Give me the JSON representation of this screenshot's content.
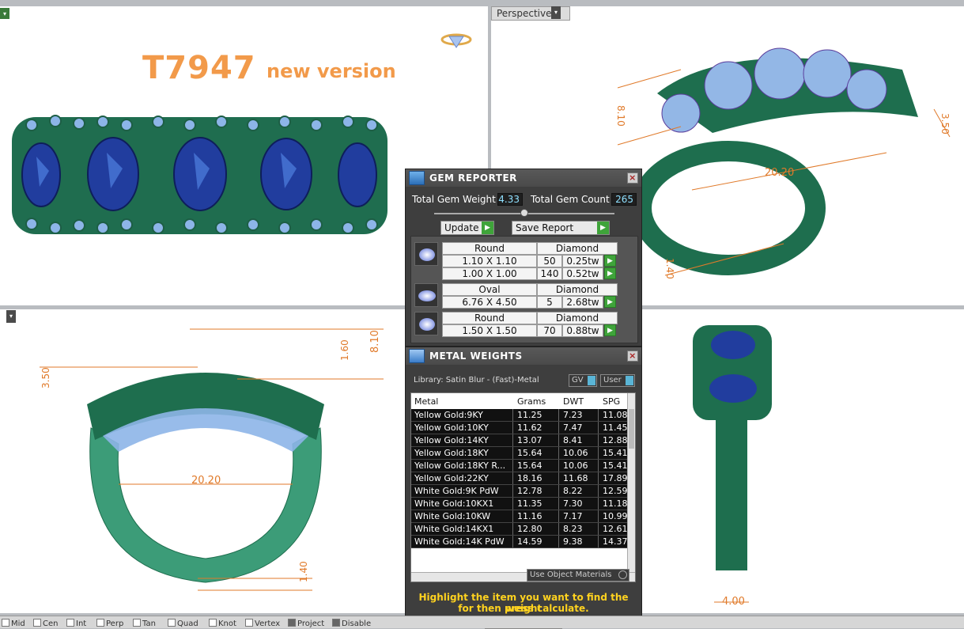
{
  "viewports": {
    "top_left": {
      "title_code": "T7947",
      "title_suffix": "new version"
    },
    "top_right": {
      "label": "Perspective",
      "dims": [
        "8.10",
        "3.50",
        "20.20",
        "1.40"
      ]
    },
    "bottom_left": {
      "dims": [
        "8.10",
        "1.60",
        "3.50",
        "20.20",
        "1.40"
      ]
    },
    "bottom_right": {
      "dims": [
        "4.00"
      ]
    }
  },
  "gem_reporter": {
    "title": "GEM REPORTER",
    "close": "×",
    "total_weight_label": "Total Gem Weight",
    "total_weight_value": "4.33",
    "total_count_label": "Total Gem Count",
    "total_count_value": "265",
    "update_label": "Update",
    "save_report_label": "Save Report",
    "groups": [
      {
        "shape": "Round",
        "material": "Diamond",
        "rows": [
          {
            "size": "1.10 X 1.10",
            "count": "50",
            "tw": "0.25tw"
          },
          {
            "size": "1.00 X 1.00",
            "count": "140",
            "tw": "0.52tw"
          }
        ]
      },
      {
        "shape": "Oval",
        "material": "Diamond",
        "rows": [
          {
            "size": "6.76 X 4.50",
            "count": "5",
            "tw": "2.68tw"
          }
        ]
      },
      {
        "shape": "Round",
        "material": "Diamond",
        "rows": [
          {
            "size": "1.50 X 1.50",
            "count": "70",
            "tw": "0.88tw"
          }
        ]
      }
    ]
  },
  "metal_weights": {
    "title": "METAL WEIGHTS",
    "close": "×",
    "library": "Library: Satin Blur - (Fast)-Metal",
    "gv_label": "GV",
    "user_label": "User",
    "columns": [
      "Metal",
      "Grams",
      "DWT",
      "SPG"
    ],
    "rows": [
      [
        "Yellow Gold:9KY",
        "11.25",
        "7.23",
        "11.08"
      ],
      [
        "Yellow Gold:10KY",
        "11.62",
        "7.47",
        "11.45"
      ],
      [
        "Yellow Gold:14KY",
        "13.07",
        "8.41",
        "12.88"
      ],
      [
        "Yellow Gold:18KY",
        "15.64",
        "10.06",
        "15.41"
      ],
      [
        "Yellow Gold:18KY R...",
        "15.64",
        "10.06",
        "15.41"
      ],
      [
        "Yellow Gold:22KY",
        "18.16",
        "11.68",
        "17.89"
      ],
      [
        "White Gold:9K PdW",
        "12.78",
        "8.22",
        "12.59"
      ],
      [
        "White Gold:10KX1",
        "11.35",
        "7.30",
        "11.18"
      ],
      [
        "White Gold:10KW",
        "11.16",
        "7.17",
        "10.99"
      ],
      [
        "White Gold:14KX1",
        "12.80",
        "8.23",
        "12.61"
      ],
      [
        "White Gold:14K PdW",
        "14.59",
        "9.38",
        "14.37"
      ]
    ],
    "use_object_materials": "Use Object Materials",
    "notice_line1": "Highlight the item you want to find the weight",
    "notice_line2": "for then press calculate."
  },
  "statusbar": {
    "items": [
      "Mid",
      "Cen",
      "Int",
      "Perp",
      "Tan",
      "Quad",
      "Knot",
      "Vertex",
      "Project",
      "Disable"
    ]
  }
}
